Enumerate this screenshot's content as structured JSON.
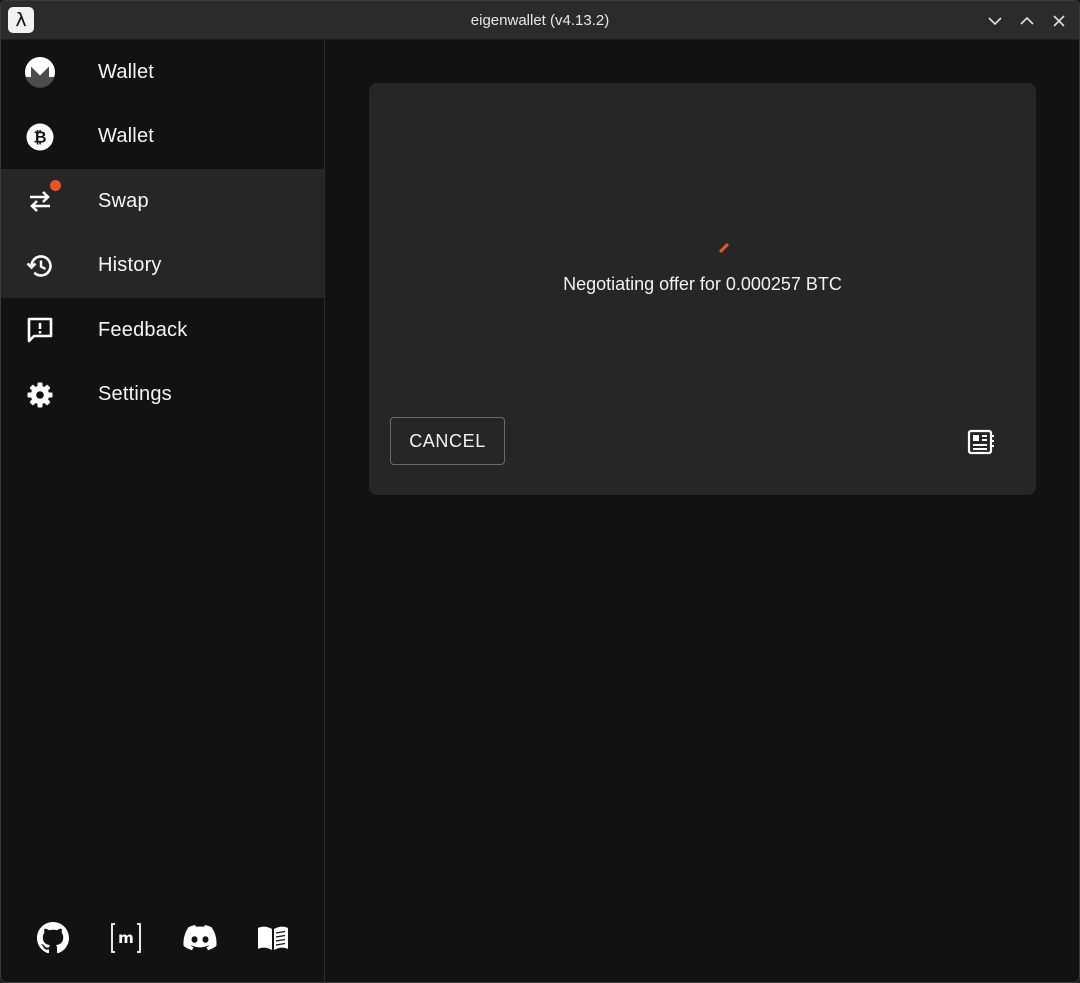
{
  "window": {
    "title": "eigenwallet (v4.13.2)",
    "app_icon_glyph": "λ",
    "controls": [
      "minimize-icon",
      "maximize-icon",
      "close-icon"
    ]
  },
  "sidebar": {
    "items": [
      {
        "label": "Wallet",
        "icon": "monero-icon",
        "selected": false
      },
      {
        "label": "Wallet",
        "icon": "bitcoin-icon",
        "selected": false
      },
      {
        "label": "Swap",
        "icon": "swap-arrows-icon",
        "selected": true,
        "badge": true
      },
      {
        "label": "History",
        "icon": "history-icon",
        "selected": true
      },
      {
        "label": "Feedback",
        "icon": "feedback-icon",
        "selected": false
      },
      {
        "label": "Settings",
        "icon": "gear-icon",
        "selected": false
      }
    ],
    "footer_links": [
      {
        "icon": "github-icon"
      },
      {
        "icon": "matrix-icon",
        "glyph": "[m]"
      },
      {
        "icon": "discord-icon"
      },
      {
        "icon": "book-icon"
      }
    ]
  },
  "main": {
    "status_text": "Negotiating offer for 0.000257 BTC",
    "cancel_label": "CANCEL",
    "logs_icon": "logs-icon"
  },
  "colors": {
    "accent": "#e9531f",
    "background": "#121212",
    "card": "#262626",
    "selected": "#262626"
  }
}
